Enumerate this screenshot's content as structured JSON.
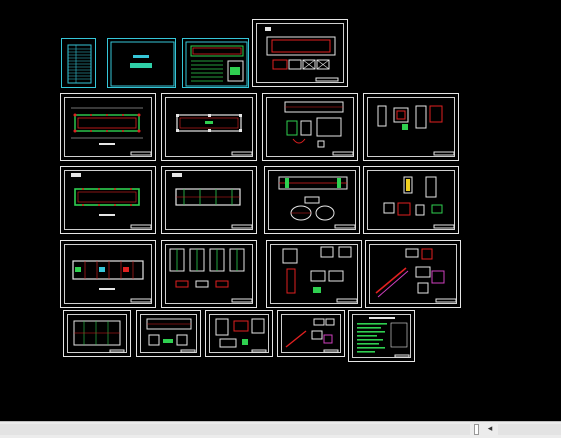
{
  "viewport": {
    "background": "#000000",
    "sheet_color": "#e6e6e6",
    "cyan_color": "#36c6d8"
  },
  "scrollbar": {
    "left_arrow_icon": "chevron-left-icon",
    "left_arrow_glyph": "◂"
  }
}
